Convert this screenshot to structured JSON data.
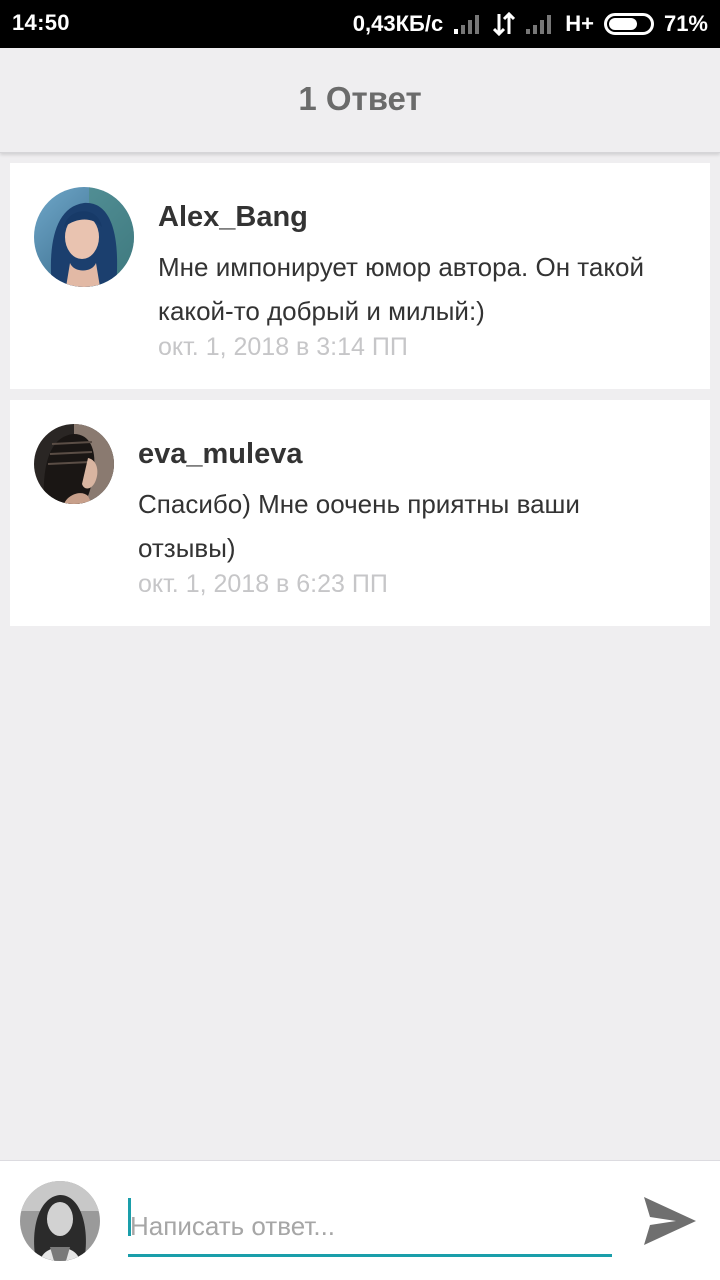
{
  "status_bar": {
    "time": "14:50",
    "network_speed": "0,43КБ/с",
    "network_type": "H+",
    "battery_percent": "71%",
    "battery_level": 0.71
  },
  "header": {
    "title": "1 Ответ"
  },
  "comments": [
    {
      "author": "Alex_Bang",
      "text": "Мне импонирует юмор автора. Он такой какой-то добрый и милый:)",
      "time": "окт. 1, 2018 в 3:14 ПП",
      "avatar_icon": "user-avatar-photo"
    },
    {
      "author": "eva_muleva",
      "text": "Спасибо) Мне оочень приятны ваши отзывы)",
      "time": "окт. 1, 2018 в 6:23 ПП",
      "avatar_icon": "user-avatar-photo"
    }
  ],
  "composer": {
    "placeholder": "Написать ответ...",
    "value": "",
    "send_icon": "send-icon"
  },
  "colors": {
    "accent": "#1a9eaa",
    "background": "#efeef0",
    "card": "#ffffff",
    "muted_text": "#c6c6c8"
  }
}
